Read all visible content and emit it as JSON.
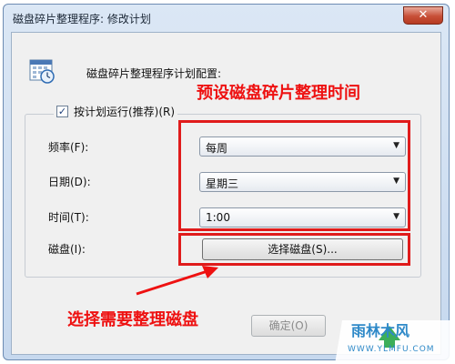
{
  "window": {
    "title": "磁盘碎片整理程序: 修改计划",
    "close_glyph": "✕"
  },
  "dialog": {
    "heading": "磁盘碎片整理程序计划配置:",
    "schedule_checkbox": {
      "label": "按计划运行(推荐)(R)",
      "checked": true
    },
    "frequency": {
      "label": "频率(F):",
      "value": "每周"
    },
    "day": {
      "label": "日期(D):",
      "value": "星期三"
    },
    "time": {
      "label": "时间(T):",
      "value": "1:00"
    },
    "disk": {
      "label": "磁盘(I):",
      "button": "选择磁盘(S)..."
    },
    "ok_button": "确定(O)"
  },
  "annotations": {
    "top": "预设磁盘碎片整理时间",
    "bottom": "选择需要整理磁盘",
    "color": "#ee1111"
  },
  "watermark": {
    "title": "雨林木风",
    "url": "WWW.YLMFU.COM"
  },
  "colors": {
    "accent": "#e01b1b",
    "window_frame": "#c6d8ee"
  }
}
